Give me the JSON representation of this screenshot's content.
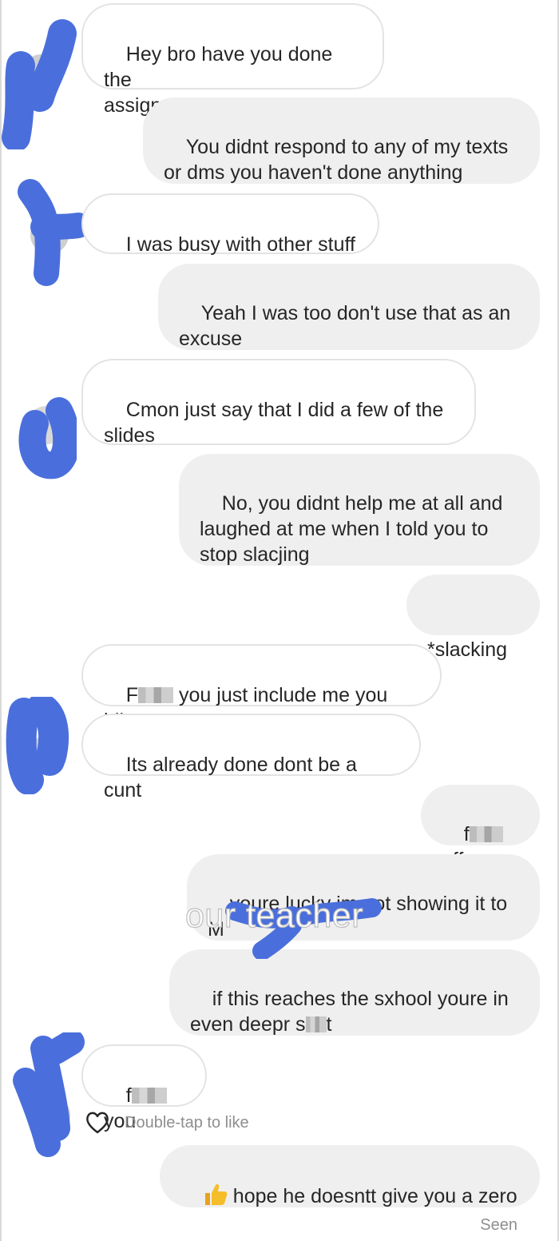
{
  "messages": [
    {
      "id": "m1",
      "side": "received",
      "text": "Hey bro have you done the\nassignment"
    },
    {
      "id": "m2",
      "side": "sent",
      "text": "You didnt respond to any of my texts\nor dms you haven't done anything"
    },
    {
      "id": "m3",
      "side": "received",
      "text": "I was busy with other stuff"
    },
    {
      "id": "m4",
      "side": "sent",
      "text": "Yeah I was too don't use that as an\nexcuse"
    },
    {
      "id": "m5",
      "side": "received",
      "text": "Cmon just say that I did a few of the\nslides"
    },
    {
      "id": "m6",
      "side": "sent",
      "text": "No, you didnt help me at all and\nlaughed at me when I told you to\nstop slacjing"
    },
    {
      "id": "m7",
      "side": "sent",
      "text": "*slacking"
    },
    {
      "id": "m8",
      "side": "received",
      "pre": "F",
      "post": " you just include me you idio"
    },
    {
      "id": "m9",
      "side": "received",
      "text": "Its already done dont be a cunt"
    },
    {
      "id": "m10",
      "side": "sent",
      "pre": "f",
      "post": " off"
    },
    {
      "id": "m11",
      "side": "sent",
      "text": "youre lucky im not showing it to\nM"
    },
    {
      "id": "m12",
      "side": "sent",
      "line1": "if this reaches the sxhool youre in",
      "pre": "even deepr s",
      "post": "t"
    },
    {
      "id": "m13",
      "side": "received",
      "pre": "f",
      "post": " you"
    },
    {
      "id": "m14",
      "side": "sent",
      "text": "hope he doesntt give you a zero",
      "emoji": "thumbs-up-icon"
    }
  ],
  "overlay_text": "our teacher",
  "like_hint": "Double-tap to like",
  "seen_label": "Seen",
  "colors": {
    "sent_bubble": "#efefef",
    "received_border": "#e3e3e3",
    "scribble": "#4a6fdc",
    "meta_text": "#8e8e8e"
  }
}
